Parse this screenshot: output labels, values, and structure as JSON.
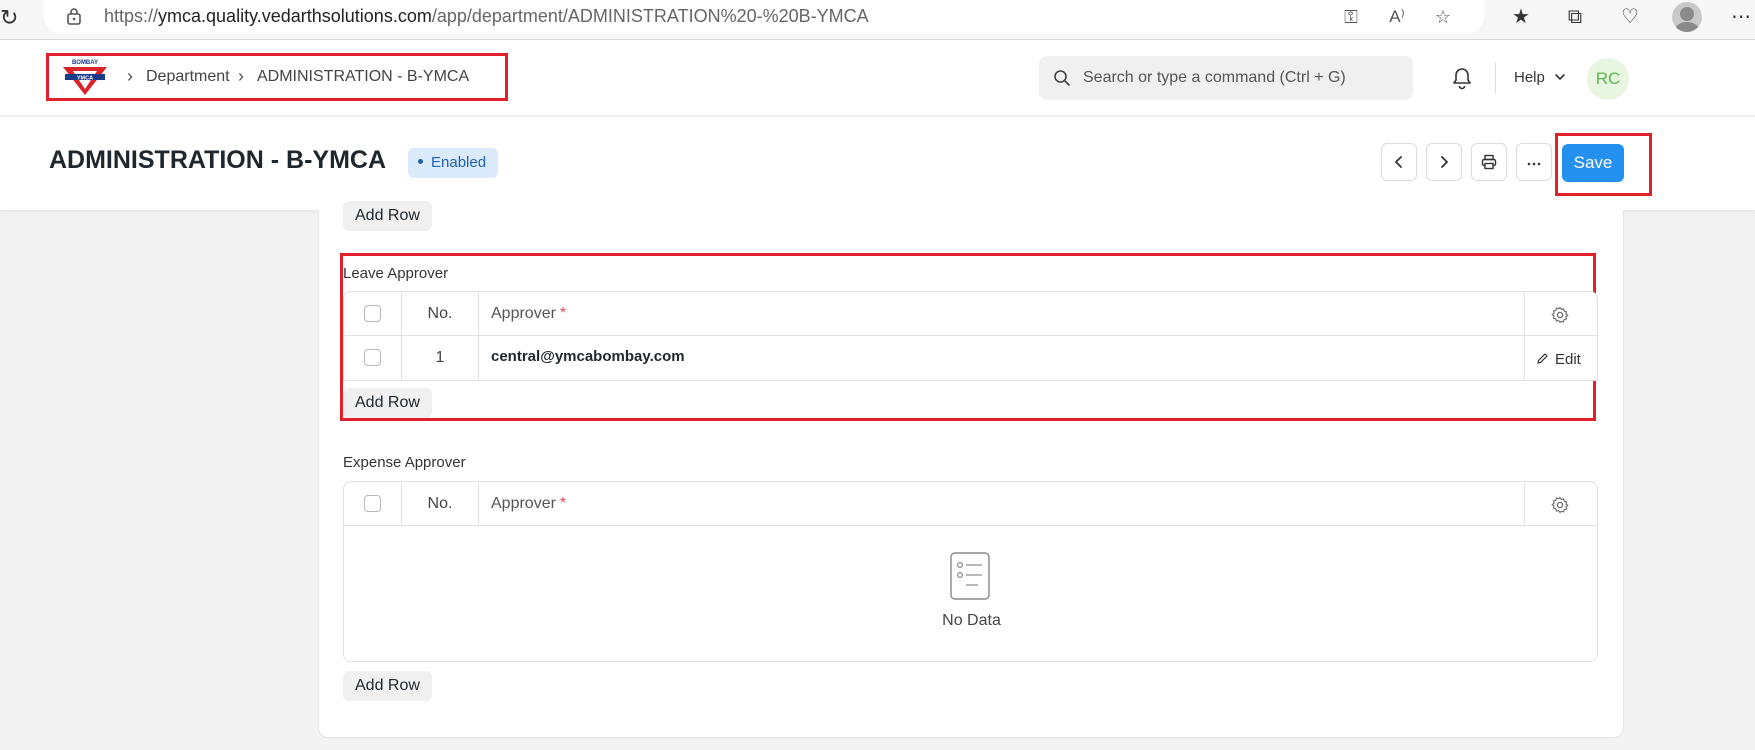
{
  "browser": {
    "url_prefix": "https://",
    "url_host": "ymca.quality.vedarthsolutions.com",
    "url_path": "/app/department/ADMINISTRATION%20-%20B-YMCA"
  },
  "navbar": {
    "logo_text_top": "BOMBAY",
    "logo_text_mid": "YMCA",
    "breadcrumbs": [
      "Department",
      "ADMINISTRATION - B-YMCA"
    ],
    "search_placeholder": "Search or type a command (Ctrl + G)",
    "help_label": "Help",
    "avatar_initials": "RC"
  },
  "page": {
    "title": "ADMINISTRATION - B-YMCA",
    "status": "Enabled",
    "save_label": "Save"
  },
  "tables": {
    "add_row_label": "Add Row",
    "col_no": "No.",
    "col_approver": "Approver",
    "required_mark": "*",
    "edit_label": "Edit",
    "leave": {
      "label": "Leave Approver",
      "rows": [
        {
          "no": "1",
          "approver": "central@ymcabombay.com"
        }
      ]
    },
    "expense": {
      "label": "Expense Approver",
      "empty_text": "No Data"
    }
  },
  "colors": {
    "primary": "#2490ef",
    "highlight": "#e0202b",
    "badge_bg": "#dcebfb",
    "badge_text": "#1f60b0"
  }
}
